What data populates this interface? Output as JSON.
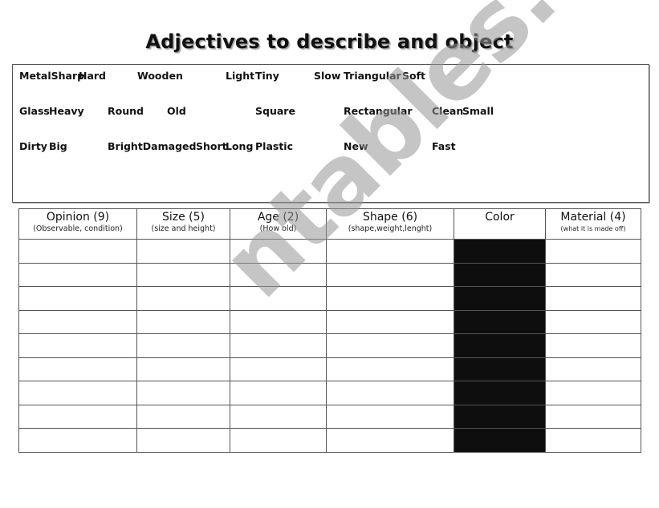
{
  "title": "Adjectives to describe and object",
  "word_bank": {
    "row1": [
      "MetalSharp",
      "Hard",
      "Wooden",
      "Light",
      "Tiny",
      "Slow",
      "Triangular",
      "Soft"
    ],
    "row2": [
      "Glass",
      "Heavy",
      "Round",
      "Old",
      "Square",
      "Rectangular",
      "Clean",
      "Small"
    ],
    "row3": [
      "Dirty",
      "Big",
      "BrightDamaged",
      "Short",
      "Long",
      "Plastic",
      "New",
      "Fast"
    ]
  },
  "table": {
    "columns": [
      {
        "label": "Opinion (9)",
        "sub": "(Observable, condition)"
      },
      {
        "label": "Size (5)",
        "sub": "(size and height)"
      },
      {
        "label": "Age (2)",
        "sub": "(How old)"
      },
      {
        "label": "Shape (6)",
        "sub": "(shape,weight,lenght)"
      },
      {
        "label": "Color",
        "sub": ""
      },
      {
        "label": "Material (4)",
        "sub": "(what it is made off)"
      }
    ],
    "row_count": 9,
    "color_column_fill": "#0e0e0e"
  },
  "watermark": "ntables.com"
}
